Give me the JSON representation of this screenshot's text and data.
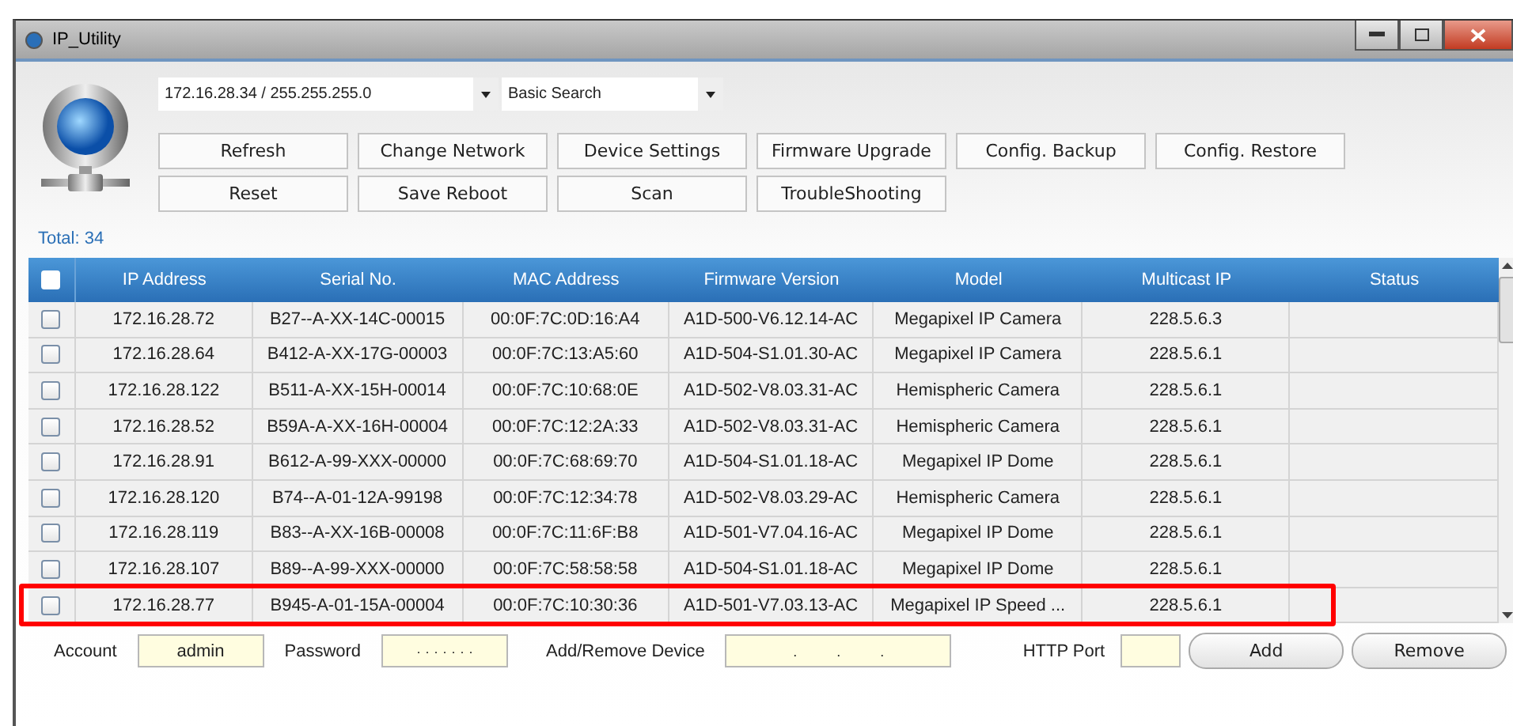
{
  "window": {
    "title": "IP_Utility"
  },
  "network_select": {
    "value": "172.16.28.34 / 255.255.255.0"
  },
  "search_select": {
    "value": "Basic Search"
  },
  "buttons": [
    [
      "Refresh",
      "Change Network",
      "Device Settings",
      "Firmware Upgrade",
      "Config. Backup",
      "Config. Restore"
    ],
    [
      "Reset",
      "Save Reboot",
      "Scan",
      "TroubleShooting"
    ]
  ],
  "total": "Total: 34",
  "table": {
    "select_all": {
      "checked": false
    },
    "columns": [
      "IP Address",
      "Serial No.",
      "MAC Address",
      "Firmware Version",
      "Model",
      "Multicast IP",
      "Status"
    ],
    "rows": [
      {
        "checked": false,
        "highlighted": false,
        "cells": [
          "172.16.28.72",
          "B27--A-XX-14C-00015",
          "00:0F:7C:0D:16:A4",
          "A1D-500-V6.12.14-AC",
          "Megapixel IP Camera",
          "228.5.6.3",
          ""
        ]
      },
      {
        "checked": false,
        "highlighted": false,
        "cells": [
          "172.16.28.64",
          "B412-A-XX-17G-00003",
          "00:0F:7C:13:A5:60",
          "A1D-504-S1.01.30-AC",
          "Megapixel IP Camera",
          "228.5.6.1",
          ""
        ]
      },
      {
        "checked": false,
        "highlighted": false,
        "cells": [
          "172.16.28.122",
          "B511-A-XX-15H-00014",
          "00:0F:7C:10:68:0E",
          "A1D-502-V8.03.31-AC",
          "Hemispheric Camera",
          "228.5.6.1",
          ""
        ]
      },
      {
        "checked": false,
        "highlighted": false,
        "cells": [
          "172.16.28.52",
          "B59A-A-XX-16H-00004",
          "00:0F:7C:12:2A:33",
          "A1D-502-V8.03.31-AC",
          "Hemispheric Camera",
          "228.5.6.1",
          ""
        ]
      },
      {
        "checked": false,
        "highlighted": false,
        "cells": [
          "172.16.28.91",
          "B612-A-99-XXX-00000",
          "00:0F:7C:68:69:70",
          "A1D-504-S1.01.18-AC",
          "Megapixel IP Dome",
          "228.5.6.1",
          ""
        ]
      },
      {
        "checked": false,
        "highlighted": false,
        "cells": [
          "172.16.28.120",
          "B74--A-01-12A-99198",
          "00:0F:7C:12:34:78",
          "A1D-502-V8.03.29-AC",
          "Hemispheric Camera",
          "228.5.6.1",
          ""
        ]
      },
      {
        "checked": false,
        "highlighted": false,
        "cells": [
          "172.16.28.119",
          "B83--A-XX-16B-00008",
          "00:0F:7C:11:6F:B8",
          "A1D-501-V7.04.16-AC",
          "Megapixel IP Dome",
          "228.5.6.1",
          ""
        ]
      },
      {
        "checked": false,
        "highlighted": false,
        "cells": [
          "172.16.28.107",
          "B89--A-99-XXX-00000",
          "00:0F:7C:58:58:58",
          "A1D-504-S1.01.18-AC",
          "Megapixel IP Dome",
          "228.5.6.1",
          ""
        ]
      },
      {
        "checked": false,
        "highlighted": true,
        "cells": [
          "172.16.28.77",
          "B945-A-01-15A-00004",
          "00:0F:7C:10:30:36",
          "A1D-501-V7.03.13-AC",
          "Megapixel IP Speed ...",
          "228.5.6.1",
          ""
        ]
      }
    ]
  },
  "bottom": {
    "account_label": "Account",
    "account": "admin",
    "password_label": "Password",
    "password": "· · · · · · ·",
    "device_label": "Add/Remove Device",
    "device": ".          .          .",
    "port_label": "HTTP Port",
    "add": "Add",
    "remove": "Remove"
  }
}
